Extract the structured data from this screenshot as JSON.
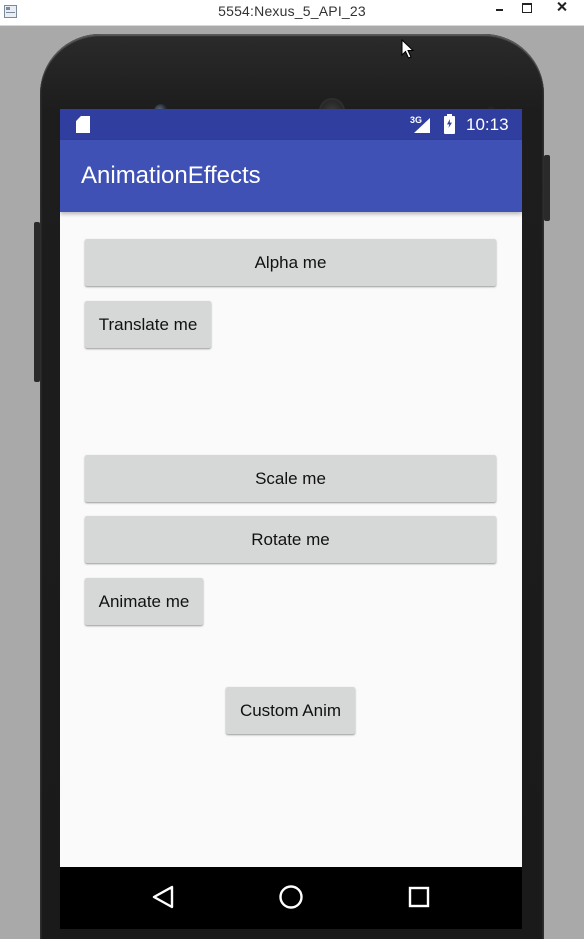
{
  "window": {
    "title": "5554:Nexus_5_API_23"
  },
  "status_bar": {
    "network_type": "3G",
    "time": "10:13"
  },
  "app_bar": {
    "title": "AnimationEffects"
  },
  "buttons": {
    "alpha": "Alpha me",
    "translate": "Translate me",
    "scale": "Scale me",
    "rotate": "Rotate me",
    "animate": "Animate me",
    "custom_anim": "Custom Anim"
  },
  "nav_bar": {
    "items": [
      "back-icon",
      "home-icon",
      "recents-icon"
    ]
  },
  "colors": {
    "status_bar": "#303f9f",
    "app_bar": "#3f51b5",
    "button_bg": "#d6d7d7",
    "screen_bg": "#fafafa",
    "nav_bar": "#000000"
  },
  "icons": {
    "window_controls": [
      "minimize-icon",
      "maximize-icon",
      "close-icon"
    ],
    "status": [
      "sd-card-icon",
      "signal-icon",
      "battery-charging-icon"
    ]
  }
}
